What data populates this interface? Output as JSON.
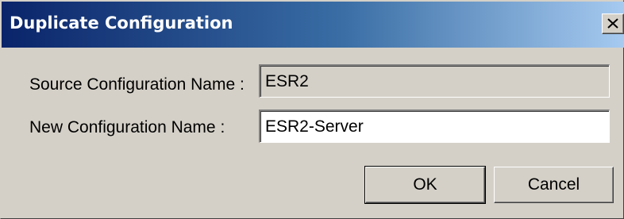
{
  "window": {
    "title": "Duplicate Configuration"
  },
  "form": {
    "source_label": "Source Configuration Name :",
    "source_value": "ESR2",
    "new_label": "New Configuration Name :",
    "new_value": "ESR2-Server"
  },
  "buttons": {
    "ok_label": "OK",
    "cancel_label": "Cancel"
  },
  "icons": {
    "close": "close-icon"
  },
  "colors": {
    "titlebar_start": "#0a246a",
    "titlebar_end": "#a6caf0",
    "dialog_face": "#d4d0c8"
  }
}
